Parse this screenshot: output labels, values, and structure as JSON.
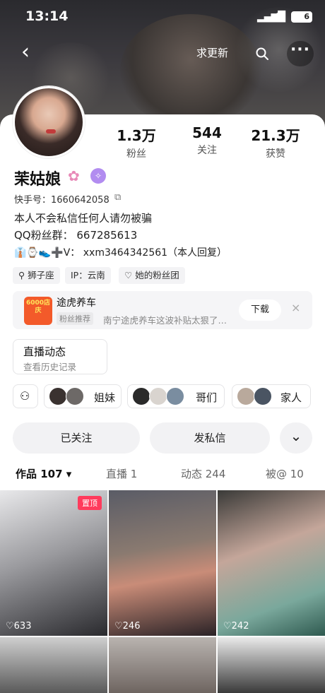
{
  "status_bar": {
    "time": "13:14",
    "battery": "6"
  },
  "nav": {
    "back": "‹",
    "request_update": "求更新",
    "search_icon": "search-icon",
    "more": "···"
  },
  "stats": [
    {
      "value": "1.3万",
      "label": "粉丝"
    },
    {
      "value": "544",
      "label": "关注"
    },
    {
      "value": "21.3万",
      "label": "获赞"
    }
  ],
  "profile": {
    "name": "茉姑娘",
    "kuaishou_id": "快手号：1660642058",
    "bio_line1": "本人不会私信任何人请勿被骗",
    "bio_line2": "QQ粉丝群：  667285613",
    "bio_line3": "➕V：  xxm3464342561（本人回复）"
  },
  "tags": [
    "狮子座",
    "IP：云南",
    "她的粉丝团"
  ],
  "ad": {
    "logo_text": "6000店庆",
    "title": "途虎养车",
    "tag": "粉丝推荐",
    "desc": "南宁途虎养车这波补贴太狠了…",
    "download": "下载",
    "close": "×"
  },
  "live": {
    "title": "直播动态",
    "subtitle": "查看历史记录"
  },
  "groups": [
    "姐妹",
    "哥们",
    "家人"
  ],
  "actions": {
    "followed": "已关注",
    "message": "发私信",
    "expand": "⌄"
  },
  "tabs": [
    {
      "label": "作品 107 ▾"
    },
    {
      "label": "直播 1"
    },
    {
      "label": "动态 244"
    },
    {
      "label": "被@ 10"
    }
  ],
  "posts": [
    {
      "likes": "♡633",
      "pinned": "置顶"
    },
    {
      "likes": "♡246"
    },
    {
      "likes": "♡242"
    }
  ],
  "colors": {
    "accent": "#ff3b5c",
    "ad_logo": "#f35a2a"
  }
}
